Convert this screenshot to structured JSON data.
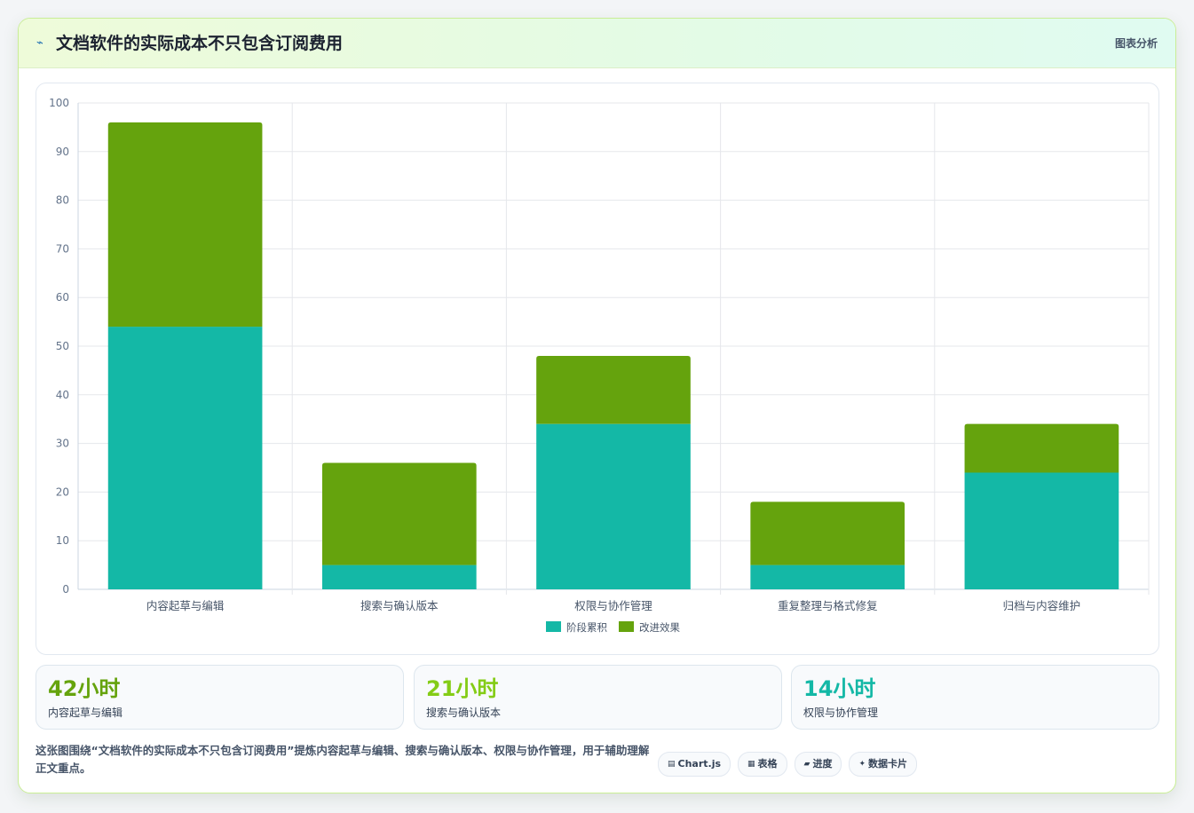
{
  "header": {
    "icon": "chart-icon",
    "title": "文档软件的实际成本不只包含订阅费用",
    "badge": "图表分析"
  },
  "colors": {
    "series1": "#14b8a6",
    "series2": "#65a30d",
    "stat1": "#65a30d",
    "stat2": "#84cc16",
    "stat3": "#14b8a6"
  },
  "chart_data": {
    "type": "bar",
    "stacked": true,
    "categories": [
      "内容起草与编辑",
      "搜索与确认版本",
      "权限与协作管理",
      "重复整理与格式修复",
      "归档与内容维护"
    ],
    "series": [
      {
        "name": "阶段累积",
        "values": [
          54,
          5,
          34,
          5,
          24
        ]
      },
      {
        "name": "改进效果",
        "values": [
          42,
          21,
          14,
          13,
          10
        ]
      }
    ],
    "ylim": [
      0,
      100
    ],
    "yticks": [
      0,
      10,
      20,
      30,
      40,
      50,
      60,
      70,
      80,
      90,
      100
    ],
    "grid": true,
    "legend": "bottom"
  },
  "stats": [
    {
      "value": "42小时",
      "label": "内容起草与编辑"
    },
    {
      "value": "21小时",
      "label": "搜索与确认版本"
    },
    {
      "value": "14小时",
      "label": "权限与协作管理"
    }
  ],
  "summary": "这张图围绕“文档软件的实际成本不只包含订阅费用”提炼内容起草与编辑、搜索与确认版本、权限与协作管理，用于辅助理解正文重点。",
  "tags": [
    {
      "icon": "server-icon",
      "glyph": "▤",
      "label": "Chart.js"
    },
    {
      "icon": "table-icon",
      "glyph": "▦",
      "label": "表格"
    },
    {
      "icon": "progress-icon",
      "glyph": "▰",
      "label": "进度"
    },
    {
      "icon": "sparkle-icon",
      "glyph": "✦",
      "label": "数据卡片"
    }
  ]
}
